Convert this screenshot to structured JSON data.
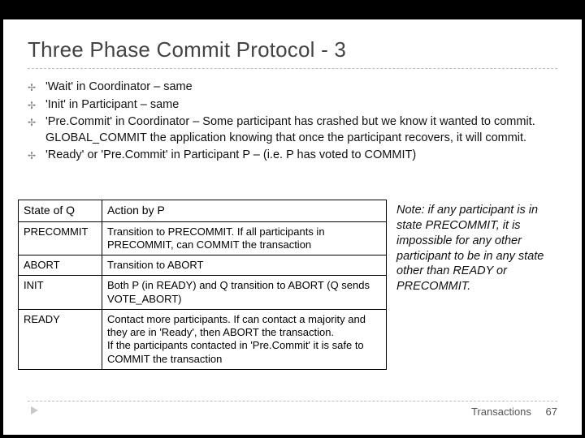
{
  "title": "Three Phase Commit Protocol - 3",
  "bullets": [
    "'Wait' in Coordinator – same",
    "'Init' in Participant – same",
    "'Pre.Commit' in Coordinator – Some participant has crashed but we know it wanted to commit.  GLOBAL_COMMIT the application knowing that once the participant recovers, it will commit.",
    "'Ready' or 'Pre.Commit' in Participant P – (i.e. P has voted to COMMIT)"
  ],
  "table": {
    "headers": [
      "State of Q",
      "Action by P"
    ],
    "rows": [
      {
        "state": "PRECOMMIT",
        "action": "Transition to PRECOMMIT.  If all participants in PRECOMMIT, can COMMIT the transaction"
      },
      {
        "state": "ABORT",
        "action": "Transition to ABORT"
      },
      {
        "state": "INIT",
        "action": "Both P (in READY) and Q transition to ABORT (Q sends VOTE_ABORT)"
      },
      {
        "state": "READY",
        "action": "Contact more participants.  If can contact a majority and they are in 'Ready', then ABORT the transaction.\nIf the participants contacted in 'Pre.Commit' it is safe to COMMIT the transaction"
      }
    ]
  },
  "note": "Note: if any participant is in state PRECOMMIT, it is impossible for any other participant to be in any state other than READY or PRECOMMIT.",
  "footer": {
    "label": "Transactions",
    "page": "67"
  },
  "chart_data": {
    "type": "table",
    "title": "Three Phase Commit Protocol - 3",
    "columns": [
      "State of Q",
      "Action by P"
    ],
    "rows": [
      [
        "PRECOMMIT",
        "Transition to PRECOMMIT. If all participants in PRECOMMIT, can COMMIT the transaction"
      ],
      [
        "ABORT",
        "Transition to ABORT"
      ],
      [
        "INIT",
        "Both P (in READY) and Q transition to ABORT (Q sends VOTE_ABORT)"
      ],
      [
        "READY",
        "Contact more participants. If can contact a majority and they are in 'Ready', then ABORT the transaction. If the participants contacted in 'Pre.Commit' it is safe to COMMIT the transaction"
      ]
    ]
  }
}
